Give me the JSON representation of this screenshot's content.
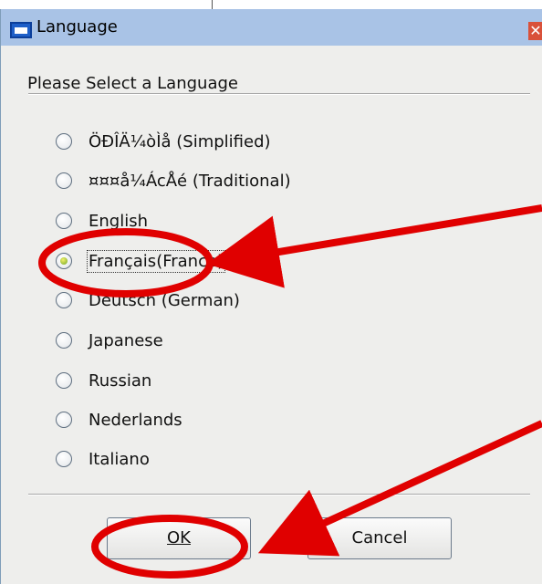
{
  "window": {
    "title": "Language",
    "close_glyph": "✕",
    "title_icon": "window-icon"
  },
  "prompt": "Please Select a Language",
  "languages": [
    {
      "label": "ÖÐÎÄ¼òÌå (Simplified)",
      "selected": false
    },
    {
      "label": "¤¤¤å¼ÁcÅé (Traditional)",
      "selected": false
    },
    {
      "label": "English",
      "selected": false
    },
    {
      "label": "Français(France)",
      "selected": true
    },
    {
      "label": "Deutsch (German)",
      "selected": false
    },
    {
      "label": "Japanese",
      "selected": false
    },
    {
      "label": "Russian",
      "selected": false
    },
    {
      "label": "Nederlands",
      "selected": false
    },
    {
      "label": "Italiano",
      "selected": false
    }
  ],
  "buttons": {
    "ok_label": "OK",
    "cancel_label": "Cancel"
  },
  "annotation_color": "#e00000"
}
